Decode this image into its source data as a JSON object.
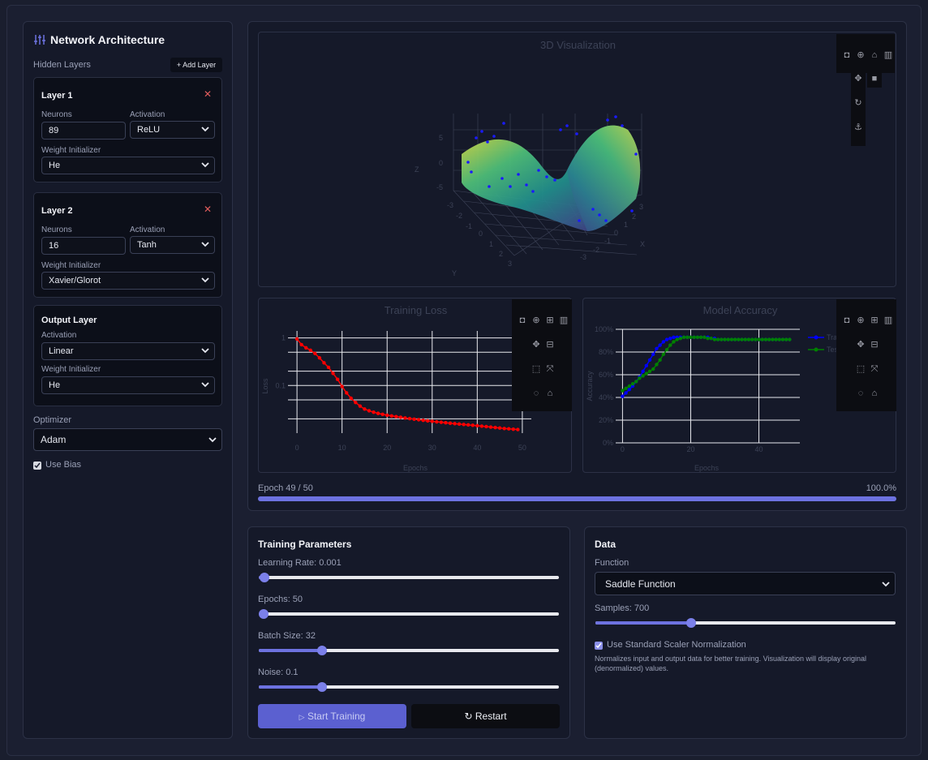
{
  "sidebar": {
    "title": "Network Architecture",
    "hidden_layers_label": "Hidden Layers",
    "add_layer_label": "+ Add Layer",
    "layers": [
      {
        "title": "Layer 1",
        "neurons_label": "Neurons",
        "neurons": "89",
        "activation_label": "Activation",
        "activation": "ReLU",
        "init_label": "Weight Initializer",
        "init": "He"
      },
      {
        "title": "Layer 2",
        "neurons_label": "Neurons",
        "neurons": "16",
        "activation_label": "Activation",
        "activation": "Tanh",
        "init_label": "Weight Initializer",
        "init": "Xavier/Glorot"
      }
    ],
    "output": {
      "title": "Output Layer",
      "activation_label": "Activation",
      "activation": "Linear",
      "init_label": "Weight Initializer",
      "init": "He"
    },
    "optimizer_label": "Optimizer",
    "optimizer": "Adam",
    "use_bias_label": "Use Bias",
    "use_bias": true
  },
  "viz3d": {
    "title": "3D Visualization",
    "axis_x": "X",
    "axis_y": "Y",
    "axis_z": "Z",
    "z_ticks": [
      "5",
      "0",
      "-5"
    ],
    "x_ticks": [
      "-3",
      "-2",
      "-1",
      "0",
      "1",
      "2",
      "3"
    ],
    "y_ticks": [
      "-3",
      "-2",
      "-1",
      "0",
      "1",
      "2",
      "3"
    ]
  },
  "progress": {
    "epoch_text": "Epoch 49 / 50",
    "percent_text": "100.0%",
    "fraction": 1.0
  },
  "training": {
    "title": "Training Parameters",
    "learning_rate_label": "Learning Rate: 0.001",
    "learning_rate_pos": 0.02,
    "epochs_label": "Epochs: 50",
    "epochs_pos": 0.015,
    "batch_label": "Batch Size: 32",
    "batch_pos": 0.21,
    "noise_label": "Noise: 0.1",
    "noise_pos": 0.21,
    "start_label": "Start Training",
    "restart_label": "Restart"
  },
  "data": {
    "title": "Data",
    "function_label": "Function",
    "function": "Saddle Function",
    "samples_label": "Samples: 700",
    "samples_pos": 0.32,
    "scaler_label": "Use Standard Scaler Normalization",
    "scaler": true,
    "scaler_help": "Normalizes input and output data for better training. Visualization will display original (denormalized) values."
  },
  "colors": {
    "accent": "#6d72e0",
    "loss": "#ff0000",
    "train_acc": "#0000ff",
    "test_acc": "#008000",
    "danger": "#e05c5c"
  },
  "chart_data": [
    {
      "type": "line",
      "title": "Training Loss",
      "xlabel": "Epochs",
      "ylabel": "Loss",
      "y_scale": "log",
      "x_ticks": [
        "0",
        "10",
        "20",
        "30",
        "40",
        "50"
      ],
      "y_ticks": [
        "1",
        "0.1"
      ],
      "xlim": [
        -2,
        52
      ],
      "ylim": [
        0.01,
        1.4
      ],
      "grid": true,
      "series": [
        {
          "x": [
            0,
            1,
            2,
            3,
            4,
            5,
            6,
            7,
            8,
            9,
            10,
            11,
            12,
            13,
            14,
            15,
            16,
            17,
            18,
            19,
            20,
            21,
            22,
            23,
            24,
            25,
            26,
            27,
            28,
            29,
            30,
            31,
            32,
            33,
            34,
            35,
            36,
            37,
            38,
            39,
            40,
            41,
            42,
            43,
            44,
            45,
            46,
            47,
            48,
            49
          ],
          "y": [
            0.95,
            0.72,
            0.62,
            0.55,
            0.47,
            0.38,
            0.3,
            0.24,
            0.18,
            0.135,
            0.095,
            0.07,
            0.054,
            0.044,
            0.037,
            0.032,
            0.0295,
            0.0275,
            0.026,
            0.0248,
            0.0238,
            0.023,
            0.0222,
            0.0215,
            0.0208,
            0.0202,
            0.0196,
            0.0191,
            0.0186,
            0.0181,
            0.0177,
            0.0173,
            0.0169,
            0.0165,
            0.0161,
            0.0158,
            0.0155,
            0.0152,
            0.0149,
            0.0146,
            0.0143,
            0.014,
            0.0137,
            0.0134,
            0.0131,
            0.0128,
            0.0125,
            0.0123,
            0.0121,
            0.0119
          ]
        }
      ]
    },
    {
      "type": "line",
      "title": "Model Accuracy",
      "xlabel": "Epochs",
      "ylabel": "Accuracy",
      "x_ticks": [
        "0",
        "20",
        "40"
      ],
      "y_ticks": [
        "0%",
        "20%",
        "40%",
        "60%",
        "80%",
        "100%"
      ],
      "xlim": [
        -2,
        52
      ],
      "ylim": [
        0,
        100
      ],
      "grid": true,
      "legend": "top-right",
      "series": [
        {
          "name": "Training Accuracy",
          "x": [
            0,
            1,
            2,
            3,
            4,
            5,
            6,
            7,
            8,
            9,
            10,
            11,
            12,
            13,
            14,
            15,
            16,
            17,
            18,
            19,
            20,
            21,
            22,
            23,
            24,
            25,
            26,
            27,
            28,
            29,
            30,
            31,
            32,
            33,
            34,
            35,
            36,
            37,
            38,
            39,
            40,
            41,
            42,
            43,
            44,
            45,
            46,
            47,
            48,
            49
          ],
          "y": [
            41,
            44,
            47,
            50,
            54,
            58,
            63,
            68,
            73,
            78,
            83,
            86,
            89,
            91,
            92,
            93,
            93,
            93,
            93,
            93,
            93,
            93,
            93,
            93,
            93,
            93,
            92,
            92,
            91,
            91,
            91,
            91,
            91,
            91,
            91,
            91,
            91,
            91,
            91,
            91,
            91,
            91,
            91,
            91,
            91,
            91,
            91,
            91,
            91,
            91
          ]
        },
        {
          "name": "Test Accuracy",
          "x": [
            0,
            1,
            2,
            3,
            4,
            5,
            6,
            7,
            8,
            9,
            10,
            11,
            12,
            13,
            14,
            15,
            16,
            17,
            18,
            19,
            20,
            21,
            22,
            23,
            24,
            25,
            26,
            27,
            28,
            29,
            30,
            31,
            32,
            33,
            34,
            35,
            36,
            37,
            38,
            39,
            40,
            41,
            42,
            43,
            44,
            45,
            46,
            47,
            48,
            49
          ],
          "y": [
            46,
            48,
            50,
            52,
            54,
            57,
            59,
            61,
            63,
            65,
            69,
            73,
            78,
            82,
            86,
            89,
            91,
            92,
            93,
            93,
            93,
            93,
            93,
            93,
            93,
            92,
            92,
            91,
            91,
            91,
            91,
            91,
            91,
            91,
            91,
            91,
            91,
            91,
            91,
            91,
            91,
            91,
            91,
            91,
            91,
            91,
            91,
            91,
            91,
            91
          ]
        }
      ]
    }
  ]
}
